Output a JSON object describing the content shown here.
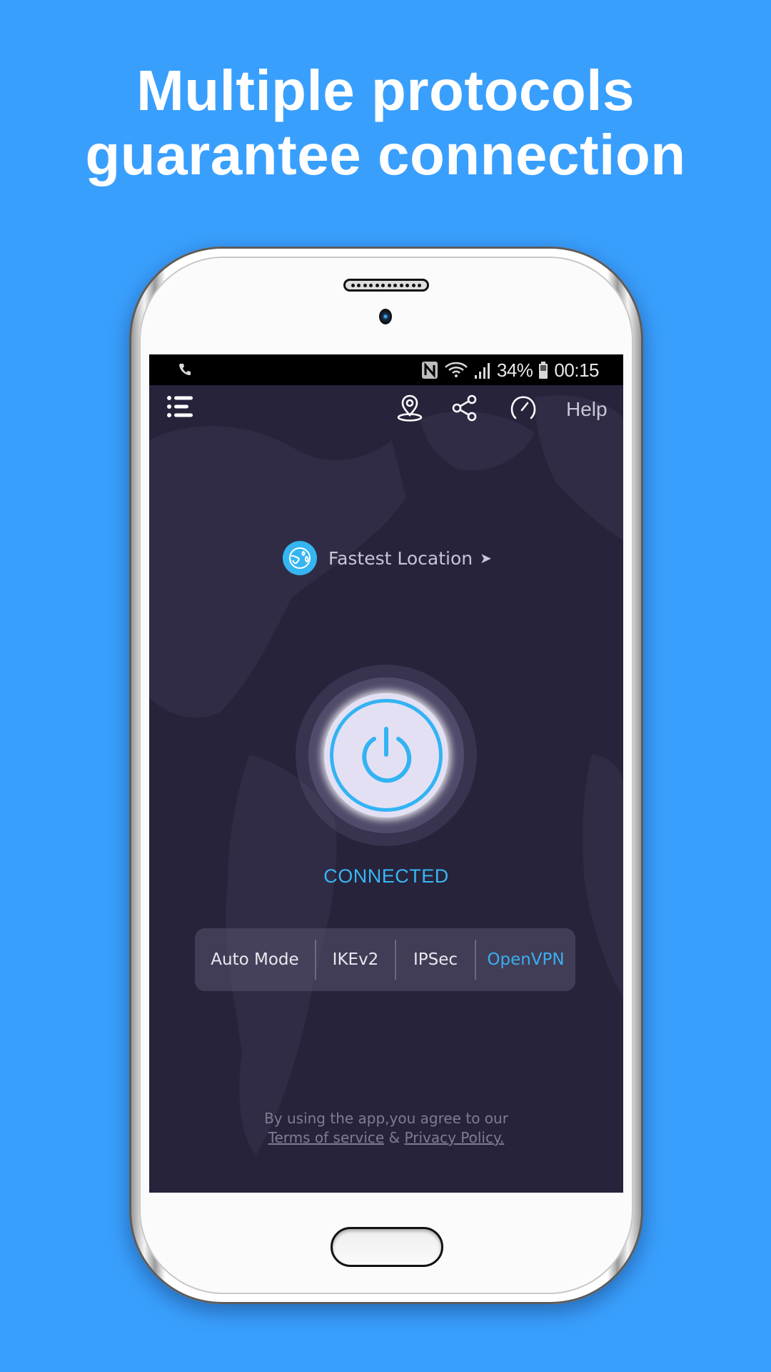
{
  "headline": {
    "line1": "Multiple protocols",
    "line2": "guarantee connection"
  },
  "colors": {
    "background": "#399ffd",
    "screen_bg": "#27233b",
    "accent": "#37b6f5"
  },
  "status_bar": {
    "left_icon": "phone-call-icon",
    "icons": [
      "nfc-icon",
      "wifi-icon",
      "signal-icon",
      "battery-icon"
    ],
    "battery": "34%",
    "time": "00:15"
  },
  "toolbar": {
    "menu_icon": "menu-icon",
    "location_icon": "location-pin-icon",
    "share_icon": "share-icon",
    "speed_icon": "speedometer-icon",
    "help_label": "Help"
  },
  "location": {
    "icon": "globe-icon",
    "label": "Fastest Location",
    "arrow": "➤"
  },
  "connection": {
    "button_icon": "power-icon",
    "status": "CONNECTED"
  },
  "protocols": {
    "items": [
      {
        "label": "Auto Mode",
        "active": false
      },
      {
        "label": "IKEv2",
        "active": false
      },
      {
        "label": "IPSec",
        "active": false
      },
      {
        "label": "OpenVPN",
        "active": true
      }
    ]
  },
  "terms": {
    "prefix": "By using the app,you agree to our",
    "tos_label": "Terms of service",
    "joiner": "&",
    "privacy_label": "Privacy Policy."
  }
}
